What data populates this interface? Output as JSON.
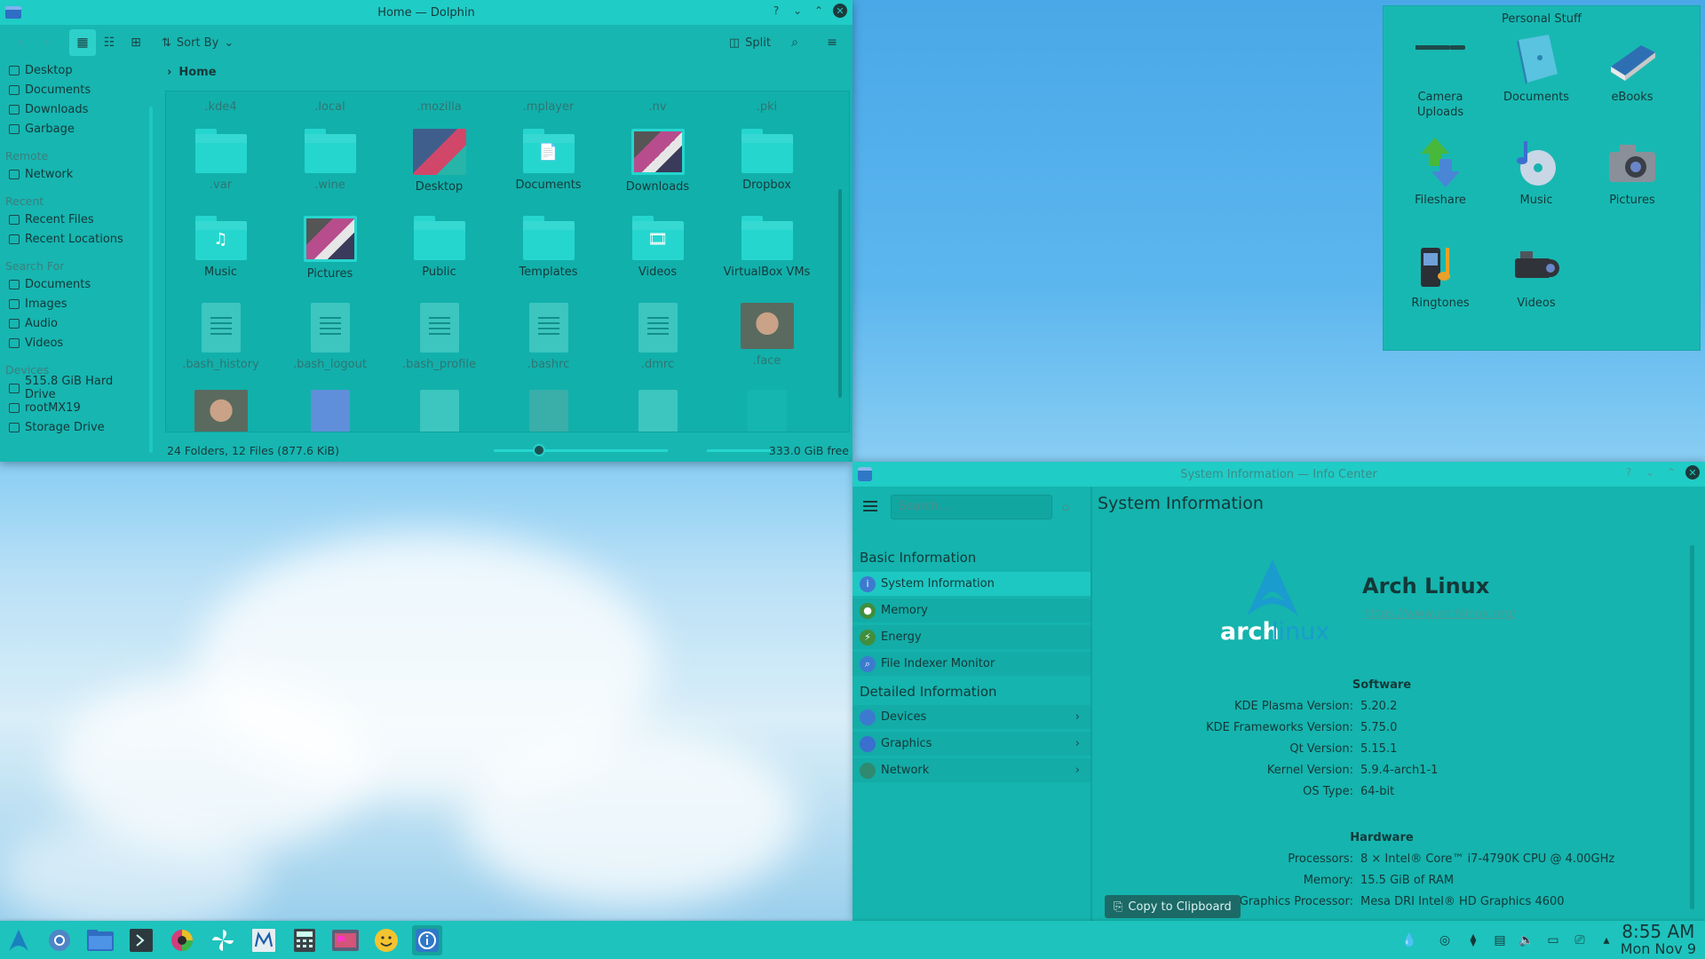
{
  "dolphin": {
    "title": "Home — Dolphin",
    "toolbar": {
      "sort_by": "Sort By",
      "split": "Split"
    },
    "breadcrumb": "Home",
    "sidebar": {
      "places": [
        "Desktop",
        "Documents",
        "Downloads",
        "Garbage"
      ],
      "remote_head": "Remote",
      "remote": [
        "Network"
      ],
      "recent_head": "Recent",
      "recent": [
        "Recent Files",
        "Recent Locations"
      ],
      "search_head": "Search For",
      "search": [
        "Documents",
        "Images",
        "Audio",
        "Videos"
      ],
      "devices_head": "Devices",
      "devices": [
        "515.8 GiB Hard Drive",
        "rootMX19",
        "Storage Drive"
      ]
    },
    "hidden_row": [
      ".kde4",
      ".local",
      ".mozilla",
      ".mplayer",
      ".nv",
      ".pki"
    ],
    "files": [
      {
        "name": ".var",
        "kind": "folder",
        "hidden": true
      },
      {
        "name": ".wine",
        "kind": "folder",
        "hidden": true
      },
      {
        "name": "Desktop",
        "kind": "desktop"
      },
      {
        "name": "Documents",
        "kind": "folder",
        "glyph": "📄"
      },
      {
        "name": "Downloads",
        "kind": "thumbfolder"
      },
      {
        "name": "Dropbox",
        "kind": "folder"
      },
      {
        "name": "Music",
        "kind": "folder",
        "glyph": "♫"
      },
      {
        "name": "Pictures",
        "kind": "thumbfolder"
      },
      {
        "name": "Public",
        "kind": "folder"
      },
      {
        "name": "Templates",
        "kind": "folder"
      },
      {
        "name": "Videos",
        "kind": "folder",
        "glyph": "🎞"
      },
      {
        "name": "VirtualBox VMs",
        "kind": "folder"
      },
      {
        "name": ".bash_history",
        "kind": "doc",
        "hidden": true
      },
      {
        "name": ".bash_logout",
        "kind": "doc",
        "hidden": true
      },
      {
        "name": ".bash_profile",
        "kind": "doc",
        "hidden": true
      },
      {
        "name": ".bashrc",
        "kind": "doc",
        "hidden": true
      },
      {
        "name": ".dmrc",
        "kind": "doc",
        "hidden": true
      },
      {
        "name": ".face",
        "kind": "photo",
        "hidden": true
      }
    ],
    "status": "24 Folders, 12 Files (877.6 KiB)",
    "free": "333.0 GiB free"
  },
  "personal": {
    "title": "Personal Stuff",
    "items": [
      {
        "label": "Camera\nUploads",
        "icon": "camera-uploads-icon"
      },
      {
        "label": "Documents",
        "icon": "documents-book-icon"
      },
      {
        "label": "eBooks",
        "icon": "ebook-icon"
      },
      {
        "label": "Fileshare",
        "icon": "fileshare-arrows-icon"
      },
      {
        "label": "Music",
        "icon": "music-cd-icon"
      },
      {
        "label": "Pictures",
        "icon": "photo-camera-icon"
      },
      {
        "label": "Ringtones",
        "icon": "ringtones-phone-icon"
      },
      {
        "label": "Videos",
        "icon": "video-camera-icon"
      }
    ]
  },
  "info": {
    "title": "System Information — Info Center",
    "search_placeholder": "Search...",
    "basic_head": "Basic Information",
    "basic": [
      "System Information",
      "Memory",
      "Energy",
      "File Indexer Monitor"
    ],
    "detail_head": "Detailed Information",
    "detail": [
      "Devices",
      "Graphics",
      "Network"
    ],
    "page_title": "System Information",
    "logo_arch": "arch",
    "logo_linux": "linux",
    "distro": "Arch Linux",
    "url": "https://www.archlinux.org/",
    "software_head": "Software",
    "software": [
      {
        "k": "KDE Plasma Version:",
        "v": "5.20.2"
      },
      {
        "k": "KDE Frameworks Version:",
        "v": "5.75.0"
      },
      {
        "k": "Qt Version:",
        "v": "5.15.1"
      },
      {
        "k": "Kernel Version:",
        "v": "5.9.4-arch1-1"
      },
      {
        "k": "OS Type:",
        "v": "64-bit"
      }
    ],
    "hardware_head": "Hardware",
    "hardware": [
      {
        "k": "Processors:",
        "v": "8 × Intel® Core™ i7-4790K CPU @ 4.00GHz"
      },
      {
        "k": "Memory:",
        "v": "15.5 GiB of RAM"
      },
      {
        "k": "Graphics Processor:",
        "v": "Mesa DRI Intel® HD Graphics 4600"
      }
    ],
    "copy_button": "Copy to Clipboard"
  },
  "taskbar": {
    "time": "8:55 AM",
    "date": "Mon Nov 9"
  }
}
